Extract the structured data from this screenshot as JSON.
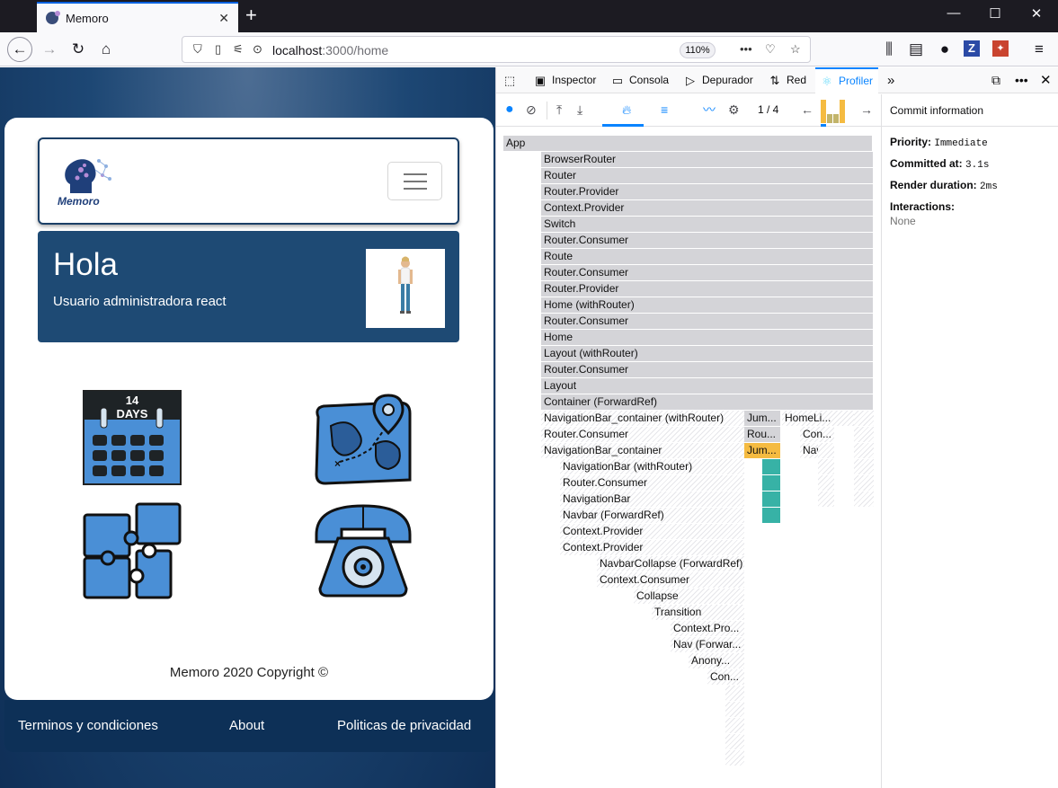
{
  "browser": {
    "tab_title": "Memoro",
    "url_host": "localhost",
    "url_path": ":3000/home",
    "zoom": "110%"
  },
  "site": {
    "logo_text": "Memoro",
    "greeting": "Hola",
    "user_line": "Usuario administradora react",
    "copyright": "Memoro 2020 Copyright ©",
    "footer_links": [
      "Terminos y condiciones",
      "About",
      "Politicas de privacidad"
    ],
    "calendar_label": "14\nDAYS"
  },
  "devtools": {
    "tabs": [
      "Inspector",
      "Consola",
      "Depurador",
      "Red",
      "Profiler"
    ],
    "commit_index": "1 / 4",
    "commit": {
      "header": "Commit information",
      "priority_label": "Priority:",
      "priority_value": "Immediate",
      "committed_label": "Committed at:",
      "committed_value": "3.1s",
      "render_label": "Render duration:",
      "render_value": "2ms",
      "interactions_label": "Interactions:",
      "interactions_value": "None"
    },
    "flame": [
      {
        "label": "App",
        "style": "g"
      },
      {
        "label": "BrowserRouter",
        "style": "g"
      },
      {
        "label": "Router",
        "style": "g"
      },
      {
        "label": "Router.Provider",
        "style": "g"
      },
      {
        "label": "Context.Provider",
        "style": "g"
      },
      {
        "label": "Switch",
        "style": "g"
      },
      {
        "label": "Router.Consumer",
        "style": "g"
      },
      {
        "label": "Route",
        "style": "g"
      },
      {
        "label": "Router.Consumer",
        "style": "g"
      },
      {
        "label": "Router.Provider",
        "style": "g"
      },
      {
        "label": "Home (withRouter)",
        "style": "g"
      },
      {
        "label": "Router.Consumer",
        "style": "g"
      },
      {
        "label": "Home",
        "style": "g"
      },
      {
        "label": "Layout (withRouter)",
        "style": "g"
      },
      {
        "label": "Router.Consumer",
        "style": "g"
      },
      {
        "label": "Layout",
        "style": "g"
      },
      {
        "label": "Container (ForwardRef)",
        "style": "g"
      },
      {
        "label": "NavigationBar_container (withRouter)",
        "style": "h"
      },
      {
        "label": "Jum...",
        "style": "g"
      },
      {
        "label": "HomeLi...",
        "style": "h"
      },
      {
        "label": "Router.Consumer",
        "style": "h"
      },
      {
        "label": "Rou...",
        "style": "g"
      },
      {
        "label": "Con...",
        "style": "h"
      },
      {
        "label": "NavigationBar_container",
        "style": "h"
      },
      {
        "label": "Jum...",
        "style": "y"
      },
      {
        "label": "Nav...",
        "style": "h"
      },
      {
        "label": "NavigationBar (withRouter)",
        "style": "h"
      },
      {
        "label": "Router.Consumer",
        "style": "h"
      },
      {
        "label": "NavigationBar",
        "style": "h"
      },
      {
        "label": "Navbar (ForwardRef)",
        "style": "h"
      },
      {
        "label": "Context.Provider",
        "style": "h"
      },
      {
        "label": "Context.Provider",
        "style": "h"
      },
      {
        "label": "NavbarCollapse (ForwardRef)",
        "style": "h"
      },
      {
        "label": "Context.Consumer",
        "style": "h"
      },
      {
        "label": "Collapse",
        "style": "h"
      },
      {
        "label": "Transition",
        "style": "h"
      },
      {
        "label": "Context.Pro...",
        "style": "h"
      },
      {
        "label": "Nav (Forwar...",
        "style": "h"
      },
      {
        "label": "Anony...",
        "style": "h"
      },
      {
        "label": "Con...",
        "style": "h"
      }
    ]
  },
  "colors": {
    "accent": "#0a84ff",
    "flame_gray": "#d4d4d8",
    "flame_yellow": "#f5bb41",
    "flame_teal": "#37b2a6",
    "navy": "#1e4a74"
  }
}
